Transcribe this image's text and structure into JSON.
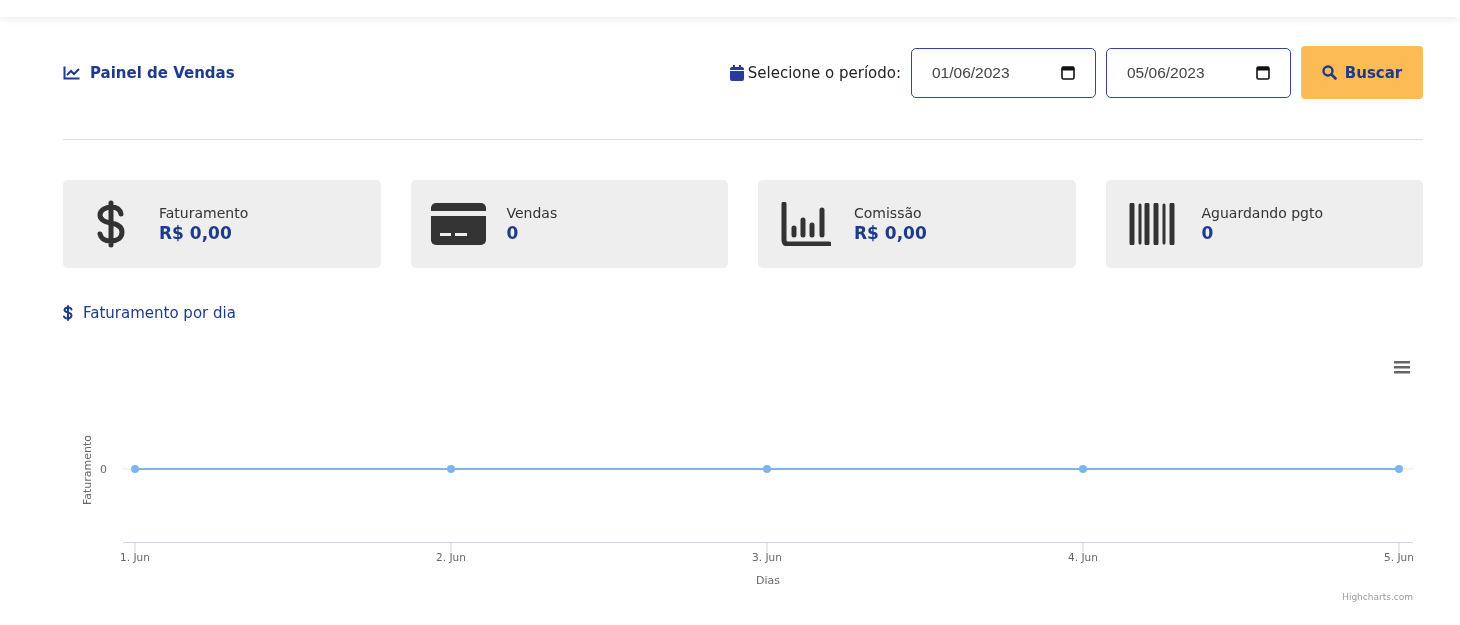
{
  "header": {
    "title": "Painel de Vendas",
    "period_label": "Selecione o período:",
    "date_start": "01/06/2023",
    "date_end": "05/06/2023",
    "search_button": "Buscar"
  },
  "cards": [
    {
      "kind": "dollar",
      "label": "Faturamento",
      "value": "R$ 0,00"
    },
    {
      "kind": "card",
      "label": "Vendas",
      "value": "0"
    },
    {
      "kind": "chart",
      "label": "Comissão",
      "value": "R$ 0,00"
    },
    {
      "kind": "barcode",
      "label": "Aguardando pgto",
      "value": "0"
    }
  ],
  "chart_section": {
    "title": "Faturamento por dia",
    "credits": "Highcharts.com",
    "y_axis_title": "Faturamento",
    "y_tick_label": "0",
    "x_tick_labels": [
      "1. Jun",
      "2. Jun",
      "3. Jun",
      "4. Jun",
      "5. Jun"
    ],
    "x_axis_title": "Dias"
  }
}
